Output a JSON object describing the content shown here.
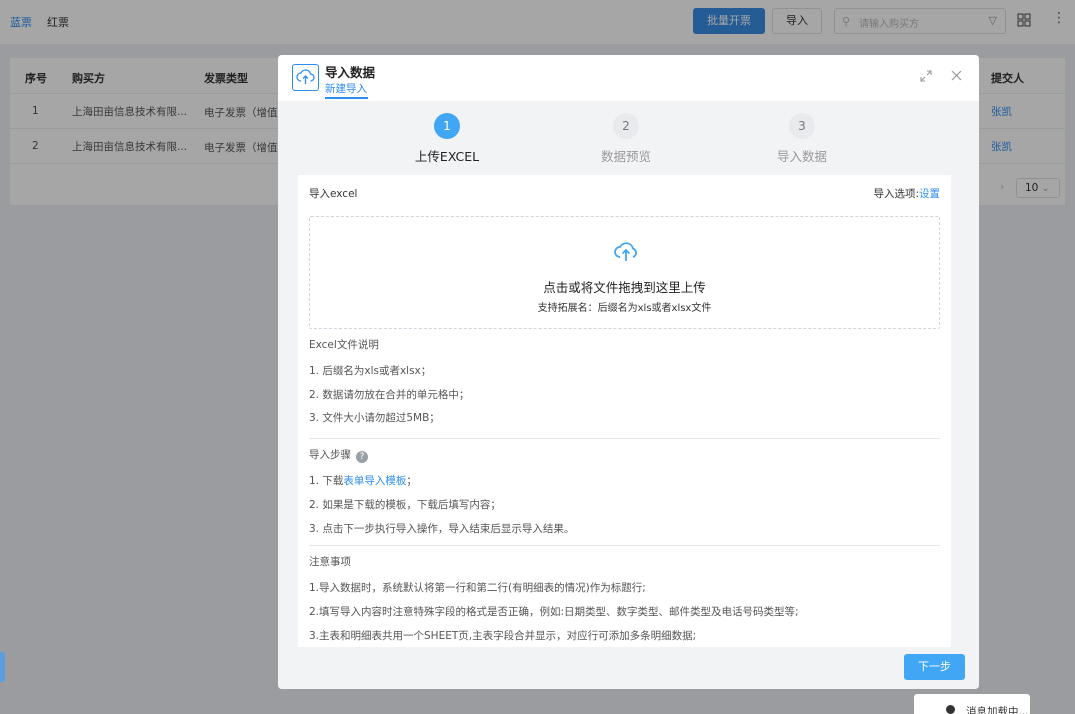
{
  "topbar": {
    "tabs": [
      "蓝票",
      "红票"
    ],
    "batch_button": "批量开票",
    "import_button": "导入",
    "search_placeholder": "请输入购买方"
  },
  "table": {
    "headers": [
      "序号",
      "购买方",
      "发票类型",
      "提交人"
    ],
    "rows": [
      {
        "index": "1",
        "buyer": "上海田亩信息技术有限...",
        "type": "电子发票（增值",
        "submitter": "张凯"
      },
      {
        "index": "2",
        "buyer": "上海田亩信息技术有限...",
        "type": "电子发票（增值",
        "submitter": "张凯"
      }
    ],
    "page_size": "10"
  },
  "toast": {
    "text": "消息加载中..."
  },
  "modal": {
    "title": "导入数据",
    "subtitle": "新建导入",
    "steps": [
      {
        "num": "1",
        "label": "上传EXCEL",
        "active": true
      },
      {
        "num": "2",
        "label": "数据预览",
        "active": false
      },
      {
        "num": "3",
        "label": "导入数据",
        "active": false
      }
    ],
    "panel_title": "导入excel",
    "import_option_label": "导入选项:",
    "import_option_link": "设置",
    "dropzone_main": "点击或将文件拖拽到这里上传",
    "dropzone_sub": "支持拓展名：后缀名为xls或者xlsx文件",
    "excel_section": {
      "title": "Excel文件说明",
      "items": [
        "1. 后缀名为xls或者xlsx；",
        "2. 数据请勿放在合并的单元格中；",
        "3. 文件大小请勿超过5MB；"
      ]
    },
    "steps_section": {
      "title": "导入步骤",
      "item1_prefix": "1. 下载",
      "item1_link": "表单导入模板",
      "item1_suffix": "；",
      "item2": "2. 如果是下载的模板，下载后填写内容；",
      "item3": "3. 点击下一步执行导入操作，导入结束后显示导入结果。"
    },
    "notes_section": {
      "title": "注意事项",
      "items": [
        "1.导入数据时，系统默认将第一行和第二行(有明细表的情况)作为标题行;",
        "2.填写导入内容时注意特殊字段的格式是否正确，例如:日期类型、数字类型、邮件类型及电话号码类型等;",
        "3.主表和明细表共用一个SHEET页,主表字段合并显示，对应行可添加多条明细数据;"
      ]
    },
    "next_button": "下一步"
  }
}
